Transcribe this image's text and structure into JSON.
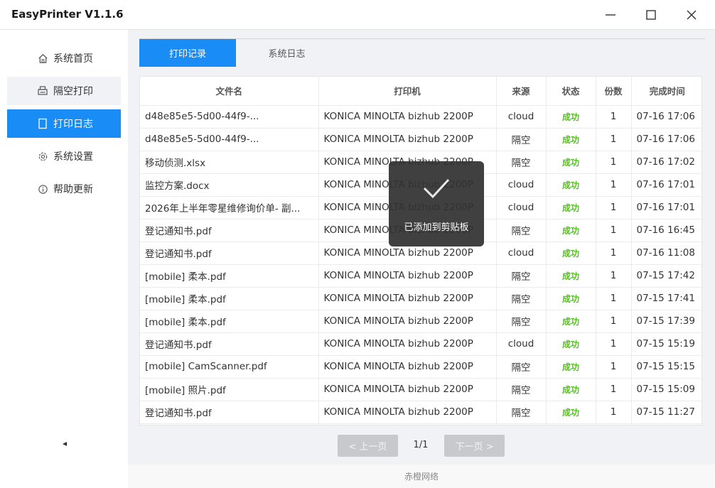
{
  "app": {
    "title": "EasyPrinter  V1.1.6"
  },
  "sidebar": {
    "items": [
      {
        "label": "系统首页",
        "icon": "home-icon"
      },
      {
        "label": "隔空打印",
        "icon": "printer-icon"
      },
      {
        "label": "打印日志",
        "icon": "document-icon"
      },
      {
        "label": "系统设置",
        "icon": "gear-icon"
      },
      {
        "label": "帮助更新",
        "icon": "info-icon"
      }
    ],
    "active_index": 2
  },
  "tabs": [
    {
      "label": "打印记录"
    },
    {
      "label": "系统日志"
    }
  ],
  "table": {
    "headers": [
      "文件名",
      "打印机",
      "来源",
      "状态",
      "份数",
      "完成时间"
    ],
    "rows": [
      {
        "file": "d48e85e5-5d00-44f9-...",
        "printer": "KONICA MINOLTA bizhub 2200P",
        "source": "cloud",
        "status": "成功",
        "copies": "1",
        "time": "07-16 17:06"
      },
      {
        "file": "d48e85e5-5d00-44f9-...",
        "printer": "KONICA MINOLTA bizhub 2200P",
        "source": "隔空",
        "status": "成功",
        "copies": "1",
        "time": "07-16 17:06"
      },
      {
        "file": "移动侦测.xlsx",
        "printer": "KONICA MINOLTA bizhub 2200P",
        "source": "隔空",
        "status": "成功",
        "copies": "1",
        "time": "07-16 17:02"
      },
      {
        "file": "监控方案.docx",
        "printer": "KONICA MINOLTA bizhub 2200P",
        "source": "cloud",
        "status": "成功",
        "copies": "1",
        "time": "07-16 17:01"
      },
      {
        "file": "2026年上半年零星维修询价单- 副...",
        "printer": "KONICA MINOLTA bizhub 2200P",
        "source": "cloud",
        "status": "成功",
        "copies": "1",
        "time": "07-16 17:01"
      },
      {
        "file": "登记通知书.pdf",
        "printer": "KONICA MINOLTA bizhub 2200P",
        "source": "隔空",
        "status": "成功",
        "copies": "1",
        "time": "07-16 16:45"
      },
      {
        "file": "登记通知书.pdf",
        "printer": "KONICA MINOLTA bizhub 2200P",
        "source": "cloud",
        "status": "成功",
        "copies": "1",
        "time": "07-16 11:08"
      },
      {
        "file": "[mobile] 柔本.pdf",
        "printer": "KONICA MINOLTA bizhub 2200P",
        "source": "隔空",
        "status": "成功",
        "copies": "1",
        "time": "07-15 17:42"
      },
      {
        "file": "[mobile] 柔本.pdf",
        "printer": "KONICA MINOLTA bizhub 2200P",
        "source": "隔空",
        "status": "成功",
        "copies": "1",
        "time": "07-15 17:41"
      },
      {
        "file": "[mobile] 柔本.pdf",
        "printer": "KONICA MINOLTA bizhub 2200P",
        "source": "隔空",
        "status": "成功",
        "copies": "1",
        "time": "07-15 17:39"
      },
      {
        "file": "登记通知书.pdf",
        "printer": "KONICA MINOLTA bizhub 2200P",
        "source": "cloud",
        "status": "成功",
        "copies": "1",
        "time": "07-15 15:19"
      },
      {
        "file": "[mobile] CamScanner.pdf",
        "printer": "KONICA MINOLTA bizhub 2200P",
        "source": "隔空",
        "status": "成功",
        "copies": "1",
        "time": "07-15 15:15"
      },
      {
        "file": "[mobile] 照片.pdf",
        "printer": "KONICA MINOLTA bizhub 2200P",
        "source": "隔空",
        "status": "成功",
        "copies": "1",
        "time": "07-15 15:09"
      },
      {
        "file": "登记通知书.pdf",
        "printer": "KONICA MINOLTA bizhub 2200P",
        "source": "隔空",
        "status": "成功",
        "copies": "1",
        "time": "07-15 11:27"
      }
    ]
  },
  "pagination": {
    "prev_label": "< 上一页",
    "page_text": "1/1",
    "next_label": "下一页 >"
  },
  "footer": {
    "text": "赤橙网络"
  },
  "toast": {
    "message": "已添加到剪贴板",
    "icon": "checkmark-icon"
  },
  "colors": {
    "accent": "#1a8cf5",
    "success": "#52c41a",
    "disabled_button": "#c8c9cc"
  }
}
